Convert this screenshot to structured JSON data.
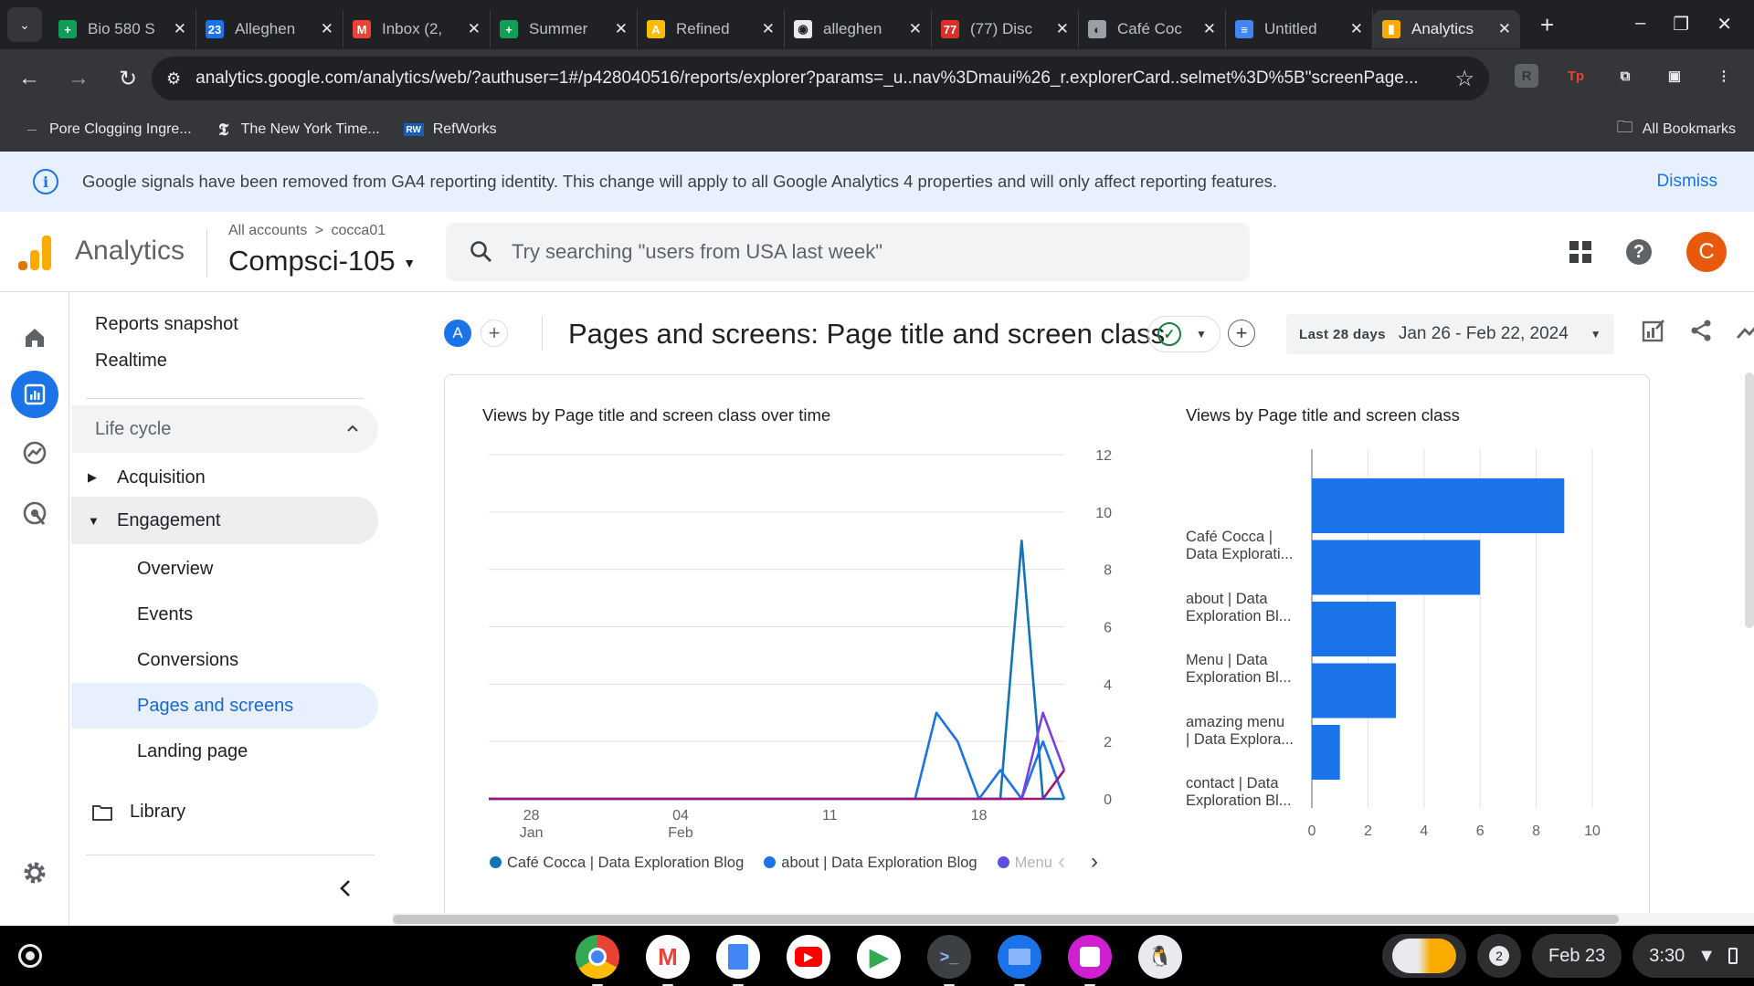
{
  "browser": {
    "tabs": [
      {
        "title": "Bio 580 S",
        "favicon": "#0f9d58",
        "glyph": "+"
      },
      {
        "title": "Alleghen",
        "favicon": "#1a73e8",
        "glyph": "23"
      },
      {
        "title": "Inbox (2,",
        "favicon": "#ea4335",
        "glyph": "M"
      },
      {
        "title": "Summer",
        "favicon": "#0f9d58",
        "glyph": "+"
      },
      {
        "title": "Refined",
        "favicon": "#fbbc04",
        "glyph": "A"
      },
      {
        "title": "alleghen",
        "favicon": "#e8eaed",
        "glyph": "◉"
      },
      {
        "title": "(77) Disc",
        "favicon": "#d93025",
        "glyph": "77"
      },
      {
        "title": "Café Coc",
        "favicon": "#9aa0a6",
        "glyph": "◐"
      },
      {
        "title": "Untitled",
        "favicon": "#4285f4",
        "glyph": "≡"
      },
      {
        "title": "Analytics",
        "favicon": "#f9ab00",
        "glyph": "▮"
      }
    ],
    "url": "analytics.google.com/analytics/web/?authuser=1#/p428040516/reports/explorer?params=_u..nav%3Dmaui%26_r.explorerCard..selmet%3D%5B\"screenPage...",
    "bookmarks": [
      {
        "label": "Pore Clogging Ingre..."
      },
      {
        "label": "The New York Time..."
      },
      {
        "label": "RefWorks"
      }
    ],
    "all_bookmarks": "All Bookmarks"
  },
  "banner": {
    "text": "Google signals have been removed from GA4 reporting identity. This change will apply to all Google Analytics 4 properties and will only affect reporting features.",
    "dismiss": "Dismiss"
  },
  "header": {
    "product": "Analytics",
    "breadcrumb_root": "All accounts",
    "breadcrumb_sep": ">",
    "account": "cocca01",
    "property": "Compsci-105",
    "search_placeholder": "Try searching \"users from USA last week\"",
    "avatar_letter": "C"
  },
  "nav": {
    "reports_snapshot": "Reports snapshot",
    "realtime": "Realtime",
    "lifecycle": "Life cycle",
    "acquisition": "Acquisition",
    "engagement": "Engagement",
    "sub_items": [
      "Overview",
      "Events",
      "Conversions",
      "Pages and screens",
      "Landing page"
    ],
    "library": "Library"
  },
  "report": {
    "compare_letter": "A",
    "title": "Pages and screens: Page title and screen class",
    "date_label": "Last 28 days",
    "date_range": "Jan 26 - Feb 22, 2024"
  },
  "line_chart_title": "Views by Page title and screen class over time",
  "bar_chart_title": "Views by Page title and screen class",
  "legend": [
    {
      "label": "Café Cocca | Data Exploration Blog",
      "color": "#1a73e8"
    },
    {
      "label": "about | Data Exploration Blog",
      "color": "#1a73e8"
    },
    {
      "label": "Menu",
      "color": "#5b4ee0"
    }
  ],
  "chart_data": [
    {
      "type": "line",
      "title": "Views by Page title and screen class over time",
      "x_ticks": [
        {
          "day": "28",
          "month": "Jan"
        },
        {
          "day": "04",
          "month": "Feb"
        },
        {
          "day": "11",
          "month": ""
        },
        {
          "day": "18",
          "month": ""
        }
      ],
      "x": [
        "Jan 26",
        "Jan 27",
        "Jan 28",
        "Jan 29",
        "Jan 30",
        "Jan 31",
        "Feb 1",
        "Feb 2",
        "Feb 3",
        "Feb 4",
        "Feb 5",
        "Feb 6",
        "Feb 7",
        "Feb 8",
        "Feb 9",
        "Feb 10",
        "Feb 11",
        "Feb 12",
        "Feb 13",
        "Feb 14",
        "Feb 15",
        "Feb 16",
        "Feb 17",
        "Feb 18",
        "Feb 19",
        "Feb 20",
        "Feb 21",
        "Feb 22"
      ],
      "ylim": [
        0,
        12
      ],
      "y_ticks": [
        0,
        2,
        4,
        6,
        8,
        10,
        12
      ],
      "series": [
        {
          "name": "Café Cocca | Data Exploration Blog",
          "color": "#1173b8",
          "values": [
            0,
            0,
            0,
            0,
            0,
            0,
            0,
            0,
            0,
            0,
            0,
            0,
            0,
            0,
            0,
            0,
            0,
            0,
            0,
            0,
            0,
            0,
            0,
            0,
            0,
            9,
            0,
            0
          ]
        },
        {
          "name": "about | Data Exploration Blog",
          "color": "#1a73e8",
          "values": [
            0,
            0,
            0,
            0,
            0,
            0,
            0,
            0,
            0,
            0,
            0,
            0,
            0,
            0,
            0,
            0,
            0,
            0,
            0,
            0,
            0,
            3,
            2,
            0,
            1,
            0,
            2,
            0
          ]
        },
        {
          "name": "Menu",
          "color": "#7b3fe4",
          "values": [
            0,
            0,
            0,
            0,
            0,
            0,
            0,
            0,
            0,
            0,
            0,
            0,
            0,
            0,
            0,
            0,
            0,
            0,
            0,
            0,
            0,
            0,
            0,
            0,
            0,
            0,
            3,
            1
          ]
        },
        {
          "name": "",
          "color": "#a0157a",
          "values": [
            0,
            0,
            0,
            0,
            0,
            0,
            0,
            0,
            0,
            0,
            0,
            0,
            0,
            0,
            0,
            0,
            0,
            0,
            0,
            0,
            0,
            0,
            0,
            0,
            0,
            0,
            0,
            1
          ]
        }
      ]
    },
    {
      "type": "bar",
      "title": "Views by Page title and screen class",
      "categories": [
        [
          "Café Cocca |",
          "Data Explorati..."
        ],
        [
          "about | Data",
          "Exploration Bl..."
        ],
        [
          "Menu | Data",
          "Exploration Bl..."
        ],
        [
          "amazing menu",
          "| Data Explora..."
        ],
        [
          "contact | Data",
          "Exploration Bl..."
        ]
      ],
      "values": [
        9,
        6,
        3,
        3,
        1
      ],
      "xlim": [
        0,
        10
      ],
      "x_ticks": [
        0,
        2,
        4,
        6,
        8,
        10
      ],
      "color": "#1a73e8"
    }
  ],
  "shelf": {
    "notifications": "2",
    "date": "Feb 23",
    "time": "3:30"
  }
}
